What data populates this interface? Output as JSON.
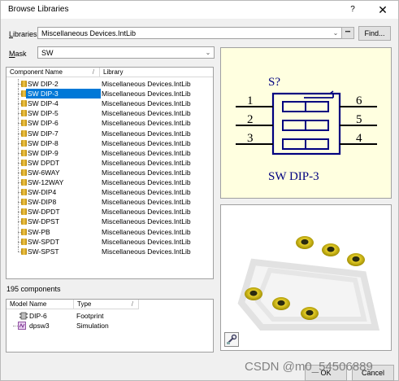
{
  "window": {
    "title": "Browse Libraries",
    "help_glyph": "?",
    "close_glyph": "✕"
  },
  "libraries": {
    "label_prefix": "",
    "label_underlined": "L",
    "label_rest": "ibraries",
    "value": "Miscellaneous Devices.IntLib",
    "more_glyph": "•••",
    "find_label": "Find..."
  },
  "mask": {
    "label_underlined": "M",
    "label_rest": "ask",
    "value": "SW"
  },
  "components": {
    "col_name": "Component Name",
    "col_library": "Library",
    "sort_glyph": "/",
    "selected": "SW DIP-3",
    "rows": [
      {
        "name": "SW DIP-2",
        "library": "Miscellaneous Devices.IntLib"
      },
      {
        "name": "SW DIP-3",
        "library": "Miscellaneous Devices.IntLib"
      },
      {
        "name": "SW DIP-4",
        "library": "Miscellaneous Devices.IntLib"
      },
      {
        "name": "SW DIP-5",
        "library": "Miscellaneous Devices.IntLib"
      },
      {
        "name": "SW DIP-6",
        "library": "Miscellaneous Devices.IntLib"
      },
      {
        "name": "SW DIP-7",
        "library": "Miscellaneous Devices.IntLib"
      },
      {
        "name": "SW DIP-8",
        "library": "Miscellaneous Devices.IntLib"
      },
      {
        "name": "SW DIP-9",
        "library": "Miscellaneous Devices.IntLib"
      },
      {
        "name": "SW DPDT",
        "library": "Miscellaneous Devices.IntLib"
      },
      {
        "name": "SW-6WAY",
        "library": "Miscellaneous Devices.IntLib"
      },
      {
        "name": "SW-12WAY",
        "library": "Miscellaneous Devices.IntLib"
      },
      {
        "name": "SW-DIP4",
        "library": "Miscellaneous Devices.IntLib"
      },
      {
        "name": "SW-DIP8",
        "library": "Miscellaneous Devices.IntLib"
      },
      {
        "name": "SW-DPDT",
        "library": "Miscellaneous Devices.IntLib"
      },
      {
        "name": "SW-DPST",
        "library": "Miscellaneous Devices.IntLib"
      },
      {
        "name": "SW-PB",
        "library": "Miscellaneous Devices.IntLib"
      },
      {
        "name": "SW-SPDT",
        "library": "Miscellaneous Devices.IntLib"
      },
      {
        "name": "SW-SPST",
        "library": "Miscellaneous Devices.IntLib"
      }
    ],
    "count_text": "195 components"
  },
  "models": {
    "col_name": "Model Name",
    "col_type": "Type",
    "sort_glyph": "/",
    "rows": [
      {
        "name": "DIP-6",
        "type": "Footprint",
        "icon": "footprint-icon"
      },
      {
        "name": "dpsw3",
        "type": "Simulation",
        "icon": "simulation-icon"
      }
    ]
  },
  "schematic": {
    "designator": "S?",
    "comment": "SW DIP-3",
    "pins_left": [
      "1",
      "2",
      "3"
    ],
    "pins_right": [
      "6",
      "5",
      "4"
    ],
    "bg_color": "#ffffe0",
    "line_color": "#000080",
    "text_color": "#000080"
  },
  "footprint_preview": {
    "pad_color": "#d4b800",
    "tool_icon": "pcb-3d-toggle-icon"
  },
  "buttons": {
    "ok_label": "OK",
    "cancel_label": "Cancel"
  },
  "watermark": "CSDN @m0_54506889"
}
